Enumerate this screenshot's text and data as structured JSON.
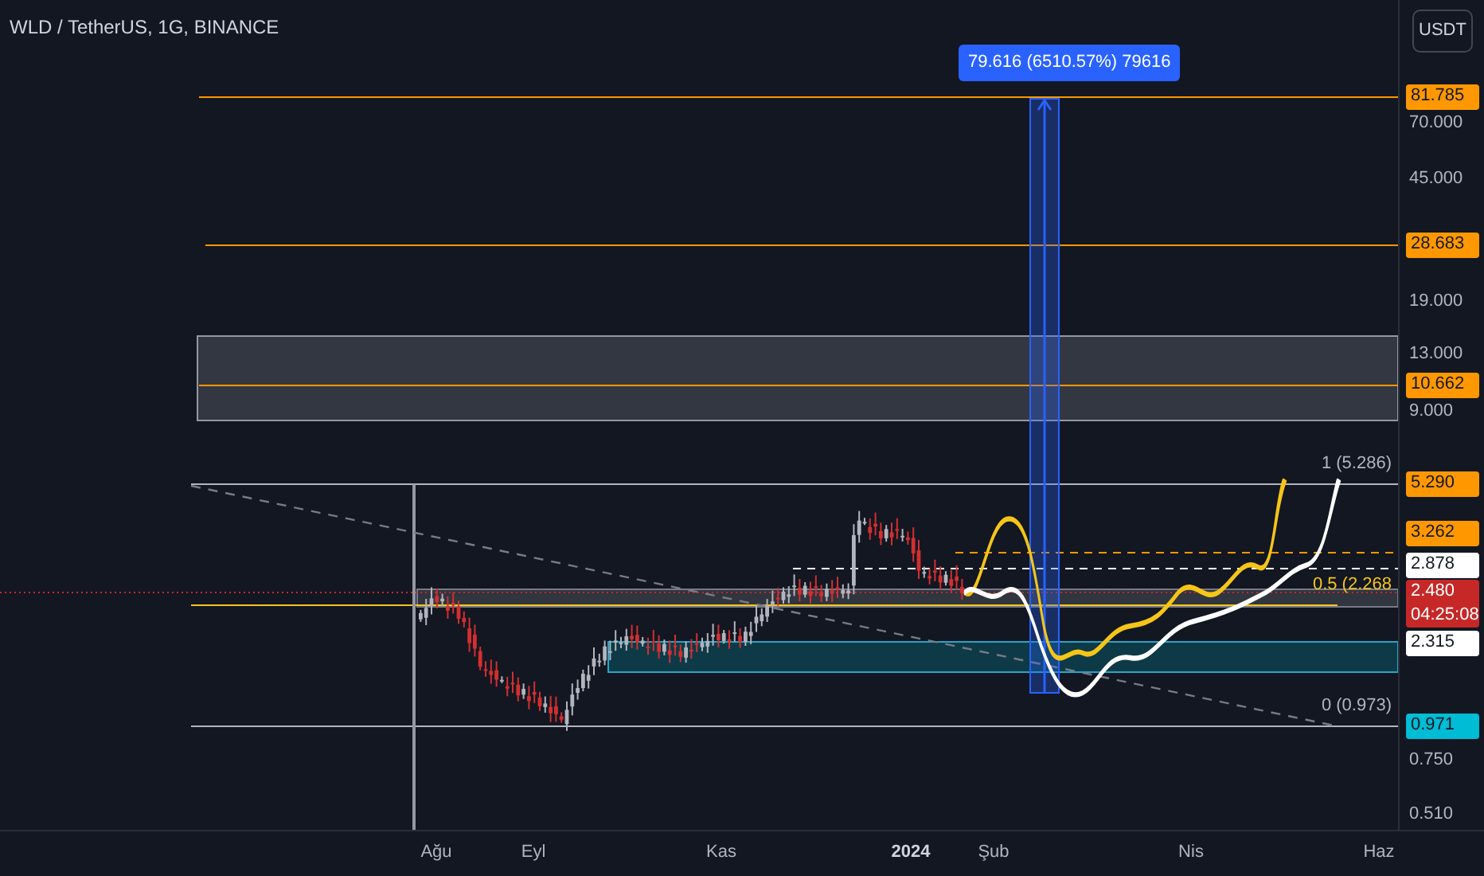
{
  "header": {
    "symbol": "WLD / TetherUS, 1G, BINANCE"
  },
  "currency_button": "USDT",
  "measure_tooltip": "79.616 (6510.57%) 79616",
  "fib_labels": [
    {
      "text": "1 (5.286)",
      "color": "#b2b5be"
    },
    {
      "text": "0.5 (2.268",
      "color": "#f5c518"
    },
    {
      "text": "0 (0.973)",
      "color": "#b2b5be"
    }
  ],
  "price_axis": {
    "ticks": [
      "70.000",
      "45.000",
      "19.000",
      "13.000",
      "9.000",
      "0.750",
      "0.510"
    ],
    "price_labels": [
      {
        "text": "81.785",
        "color": "#ff9800"
      },
      {
        "text": "28.683",
        "color": "#ff9800"
      },
      {
        "text": "10.662",
        "color": "#ff9800"
      },
      {
        "text": "5.290",
        "color": "#ff9800"
      },
      {
        "text": "3.262",
        "color": "#ff9800"
      },
      {
        "text": "2.878",
        "color": "#ffffff"
      },
      {
        "text": "2.480",
        "countdown": "04:25:08",
        "color": "#c62828"
      },
      {
        "text": "2.315",
        "color": "#ffffff"
      },
      {
        "text": "0.971",
        "color": "#00bcd4"
      }
    ]
  },
  "time_axis": {
    "labels": [
      {
        "text": "Ağu",
        "kind": "month"
      },
      {
        "text": "Eyl",
        "kind": "month"
      },
      {
        "text": "Kas",
        "kind": "month"
      },
      {
        "text": "2024",
        "kind": "year"
      },
      {
        "text": "Şub",
        "kind": "month"
      },
      {
        "text": "Nis",
        "kind": "month"
      },
      {
        "text": "Haz",
        "kind": "month"
      }
    ]
  }
}
